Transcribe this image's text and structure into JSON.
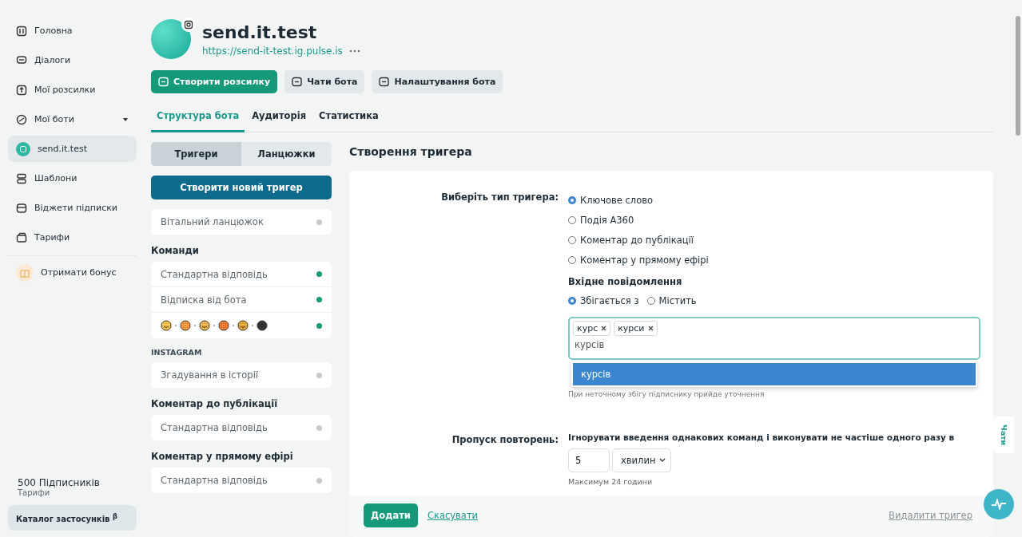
{
  "sidebar": {
    "items": [
      {
        "label": "Головна",
        "selected": false
      },
      {
        "label": "Діалоги",
        "selected": false
      },
      {
        "label": "Мої розсилки",
        "selected": false
      },
      {
        "label": "Мої боти",
        "selected": false,
        "expanded": true
      },
      {
        "label": "send.it.test",
        "selected": true
      },
      {
        "label": "Шаблони",
        "selected": false
      },
      {
        "label": "Віджети підписки",
        "selected": false
      },
      {
        "label": "Тарифи",
        "selected": false
      }
    ],
    "bonus": "Отримати бонус",
    "subscribers": "500 Підписників",
    "plan": "Тарифи",
    "catalog": "Каталог застосунків $^{β}$"
  },
  "header": {
    "name": "send.it.test",
    "url": "https://send-it-test.ig.pulse.is",
    "actions": [
      {
        "label": "Створити розсилку",
        "kind": "primary"
      },
      {
        "label": "Чати бота",
        "kind": "secondary"
      },
      {
        "label": "Налаштування бота",
        "kind": "secondary"
      }
    ]
  },
  "tabs": [
    {
      "label": "Структура бота",
      "selected": true
    },
    {
      "label": "Аудиторія",
      "selected": false
    },
    {
      "label": "Статистика",
      "selected": false
    }
  ],
  "subtabs": [
    {
      "label": "Тригери",
      "selected": true
    },
    {
      "label": "Ланцюжки",
      "selected": false
    }
  ],
  "create_trigger": "Створити новий тригер",
  "sections": [
    {
      "items": [
        {
          "label": "Вітальний ланцюжок",
          "kind": "text",
          "active": false
        }
      ]
    },
    {
      "title": "Команди",
      "kind": "group",
      "items": [
        {
          "label": "Стандартна відповідь",
          "kind": "text",
          "active": true
        },
        {
          "label": "Відписка від бота",
          "kind": "text",
          "active": true
        },
        {
          "kind": "emoji",
          "active": true
        }
      ]
    },
    {
      "title": "INSTAGRAM",
      "kind": "platform",
      "items": [
        {
          "label": "Згадування в історії",
          "kind": "text",
          "active": false
        }
      ]
    },
    {
      "title": "Коментар до публікації",
      "kind": "group",
      "items": [
        {
          "label": "Стандартна відповідь",
          "kind": "text",
          "active": false
        }
      ]
    },
    {
      "title": "Коментар у прямому ефірі",
      "kind": "group",
      "items": [
        {
          "label": "Стандартна відповідь",
          "kind": "text",
          "active": false
        }
      ]
    }
  ],
  "form": {
    "title": "Створення тригера",
    "type_label": "Виберіть тип тригера:",
    "types": [
      {
        "label": "Ключове слово",
        "selected": true
      },
      {
        "label": "Подія A360",
        "selected": false
      },
      {
        "label": "Коментар до публікації",
        "selected": false
      },
      {
        "label": "Коментар у прямому ефірі",
        "selected": false
      }
    ],
    "incoming_label": "Вхідне повідомлення",
    "match": [
      {
        "label": "Збігається з",
        "selected": true
      },
      {
        "label": "Містить",
        "selected": false
      }
    ],
    "tags": [
      "курс",
      "курси"
    ],
    "input_value": "курсів",
    "suggestion": "курсів",
    "hint": "При неточному збігу підписнику прийде уточнення",
    "repeat_label": "Пропуск повторень:",
    "repeat_text": "Ігнорувати введення однакових команд і виконувати не частіше одного разу в",
    "repeat_value": "5",
    "unit": "хвилин",
    "note": "Максимум 24 години",
    "add": "Додати",
    "cancel": "Скасувати",
    "delete": "Видалити тригер"
  },
  "chats_tab": "Чати"
}
